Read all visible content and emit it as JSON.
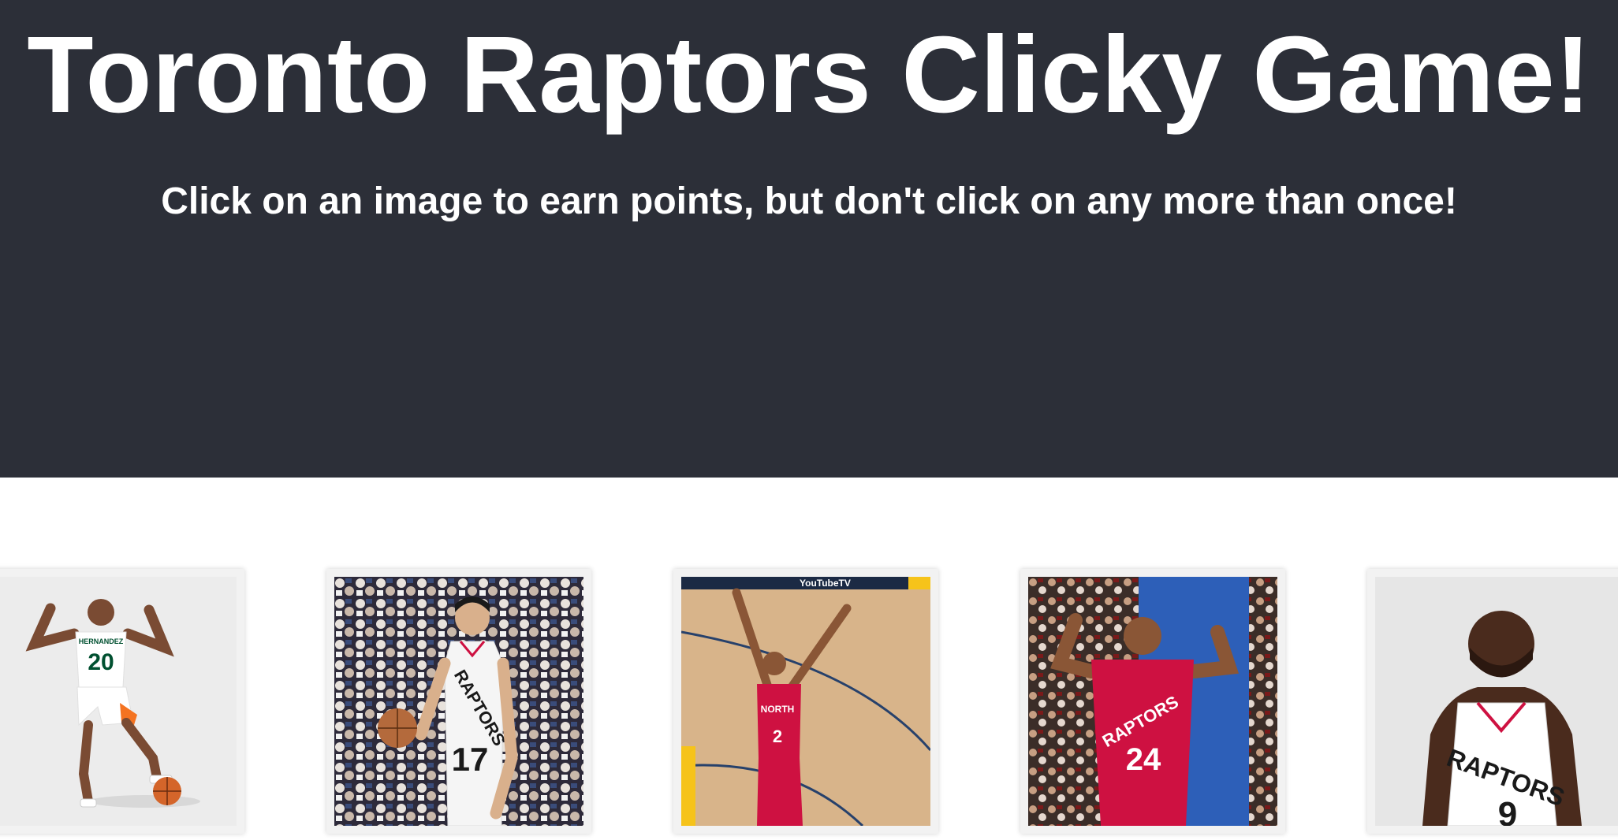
{
  "header": {
    "title": "Toronto Raptors Clicky Game!",
    "instructions": "Click on an image to earn points, but don't click on any more than once!"
  },
  "cards": [
    {
      "name": "player-card-hernandez",
      "jersey_name": "HERNANDEZ",
      "number": "20"
    },
    {
      "name": "player-card-17",
      "jersey_text": "RAPTORS",
      "number": "17"
    },
    {
      "name": "player-card-2",
      "jersey_text": "NORTH",
      "court_banner": "YouTubeTV",
      "number": "2"
    },
    {
      "name": "player-card-24",
      "jersey_text": "RAPTORS",
      "number": "24"
    },
    {
      "name": "player-card-9",
      "jersey_text": "RAPTORS",
      "number": "9"
    }
  ],
  "colors": {
    "header_bg": "#2c2f38",
    "raptors_red": "#ce1141",
    "miami_green": "#005030"
  }
}
